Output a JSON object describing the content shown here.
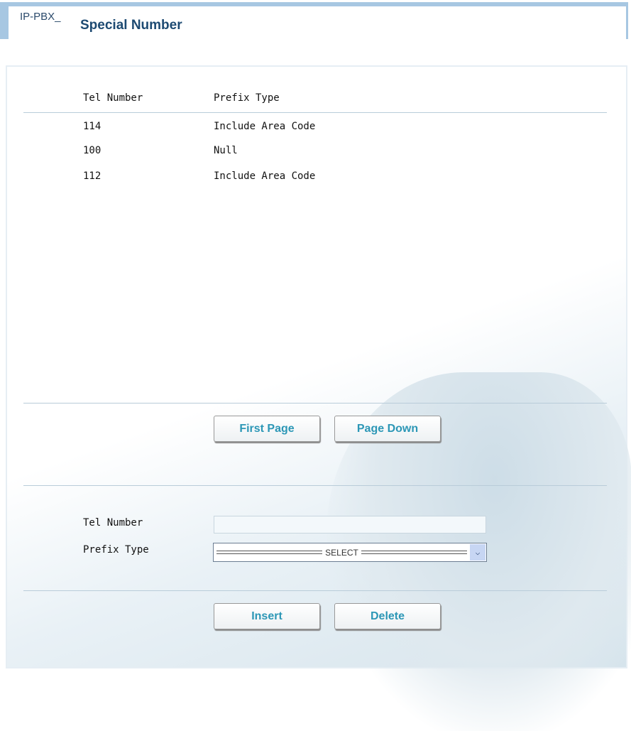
{
  "header": {
    "prefix": "IP-PBX_",
    "title": "Special Number"
  },
  "table": {
    "columns": [
      "Tel Number",
      "Prefix Type"
    ],
    "rows": [
      {
        "tel": "114",
        "prefix": "Include Area Code"
      },
      {
        "tel": "100",
        "prefix": "Null"
      },
      {
        "tel": "112",
        "prefix": "Include Area Code"
      }
    ]
  },
  "pager": {
    "first": "First Page",
    "down": "Page Down"
  },
  "form": {
    "tel_label": "Tel Number",
    "tel_value": "",
    "prefix_label": "Prefix Type",
    "prefix_selected": "SELECT"
  },
  "actions": {
    "insert": "Insert",
    "delete": "Delete"
  }
}
